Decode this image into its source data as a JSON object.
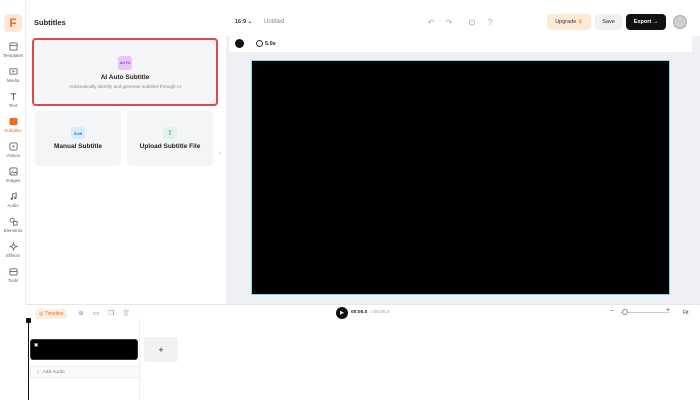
{
  "app": {
    "logo_letter": "F",
    "accent": "#f26a1b"
  },
  "sidebar": {
    "items": [
      {
        "label": "Templates",
        "icon": "templates-icon"
      },
      {
        "label": "Media",
        "icon": "media-icon"
      },
      {
        "label": "Text",
        "icon": "text-icon"
      },
      {
        "label": "Subtitles",
        "icon": "subtitles-icon",
        "active": true
      },
      {
        "label": "Videos",
        "icon": "videos-icon"
      },
      {
        "label": "Images",
        "icon": "images-icon"
      },
      {
        "label": "Audio",
        "icon": "audio-icon"
      },
      {
        "label": "Elements",
        "icon": "elements-icon"
      },
      {
        "label": "Effects",
        "icon": "effects-icon"
      },
      {
        "label": "Tools",
        "icon": "tools-icon"
      }
    ]
  },
  "panel": {
    "title": "Subtitles",
    "ai_card": {
      "badge": "AUTO",
      "title": "AI Auto Subtitle",
      "description": "Automatically identify and generate subtitles through AI"
    },
    "manual_card": {
      "badge": "SUB",
      "title": "Manual Subtitle"
    },
    "upload_card": {
      "title": "Upload Subtitle File"
    }
  },
  "topbar": {
    "ratio": "16:9",
    "project_name": "Untitled",
    "upgrade_label": "Upgrade",
    "save_label": "Save",
    "export_label": "Export"
  },
  "canvas": {
    "background_color": "#000000",
    "duration": "5.0s"
  },
  "timeline": {
    "label": "Timeline",
    "current_time": "00:05.0",
    "total_time": "/ 00:05.0",
    "fit_label": "Fit",
    "add_audio_label": "Add Audio",
    "add_clip_label": "+"
  }
}
